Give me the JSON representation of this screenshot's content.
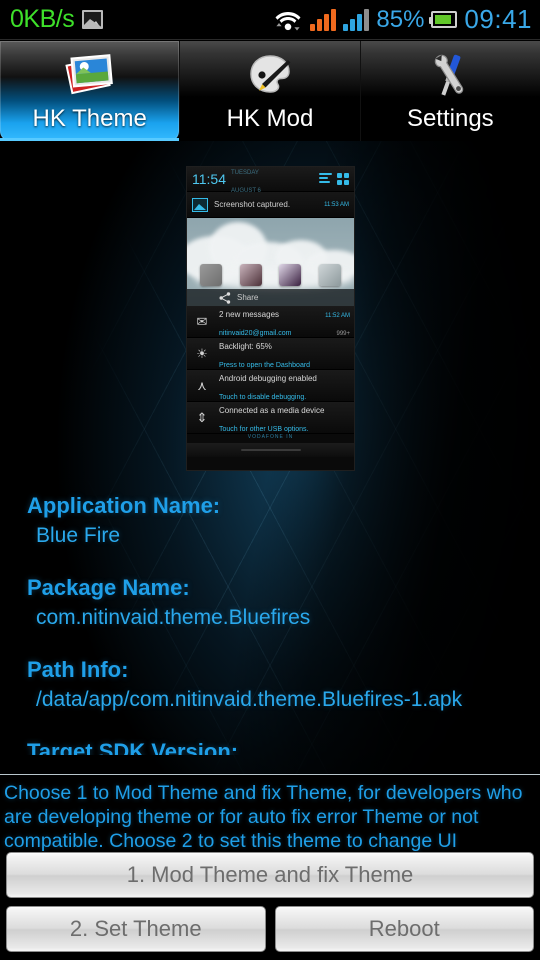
{
  "statusbar": {
    "network_speed": "0KB/s",
    "screenshot_icon": "screenshot-icon",
    "wifi_icon": "wifi-icon",
    "signal1_icon": "signal-bars-orange-icon",
    "signal2_icon": "signal-bars-blue-icon",
    "battery_percent": "85%",
    "battery_icon": "battery-icon",
    "time": "09:41",
    "colors": {
      "speed": "#3ee02a",
      "accent": "#3aa8e8",
      "battery_fill": "#62c82a"
    }
  },
  "tabs": [
    {
      "label": "HK Theme",
      "icon": "photos-icon",
      "selected": true
    },
    {
      "label": "HK Mod",
      "icon": "palette-brush-icon",
      "selected": false
    },
    {
      "label": "Settings",
      "icon": "screwdriver-wrench-icon",
      "selected": false
    }
  ],
  "preview": {
    "name": "theme-preview-image",
    "status": {
      "clock": "11:54",
      "date_line1": "TUESDAY",
      "date_line2": "AUGUST 6"
    },
    "top_notification": {
      "title": "Screenshot captured.",
      "time": "11:53 AM",
      "icon": "image-icon"
    },
    "share_label": "Share",
    "rows": [
      {
        "icon": "mail-icon",
        "title": "2 new messages",
        "subtitle": "nitinvaid20@gmail.com",
        "time": "11:52 AM",
        "badge": "999+"
      },
      {
        "icon": "brightness-icon",
        "title": "Backlight: 65%",
        "subtitle": "Press to open the Dashboard",
        "time": "",
        "badge": ""
      },
      {
        "icon": "android-icon",
        "title": "Android debugging enabled",
        "subtitle": "Touch to disable debugging.",
        "time": "",
        "badge": ""
      },
      {
        "icon": "usb-icon",
        "title": "Connected as a media device",
        "subtitle": "Touch for other USB options.",
        "time": "",
        "badge": ""
      }
    ],
    "footer": "VODAFONE IN"
  },
  "info": {
    "app_name_label": "Application Name:",
    "app_name_value": "Blue Fire",
    "package_label": "Package Name:",
    "package_value": "com.nitinvaid.theme.Bluefires",
    "path_label": "Path Info:",
    "path_value": "/data/app/com.nitinvaid.theme.Bluefires-1.apk",
    "sdk_label": "Target SDK Version:",
    "accent_color": "#1f9fe8"
  },
  "bottom": {
    "description": "Choose 1 to Mod Theme and fix Theme, for developers who are developing theme or for auto fix error Theme or not compatible. Choose 2 to set this theme to change UI",
    "buttons": {
      "mod_theme": "1. Mod Theme and fix Theme",
      "set_theme": "2. Set Theme",
      "reboot": "Reboot"
    }
  }
}
